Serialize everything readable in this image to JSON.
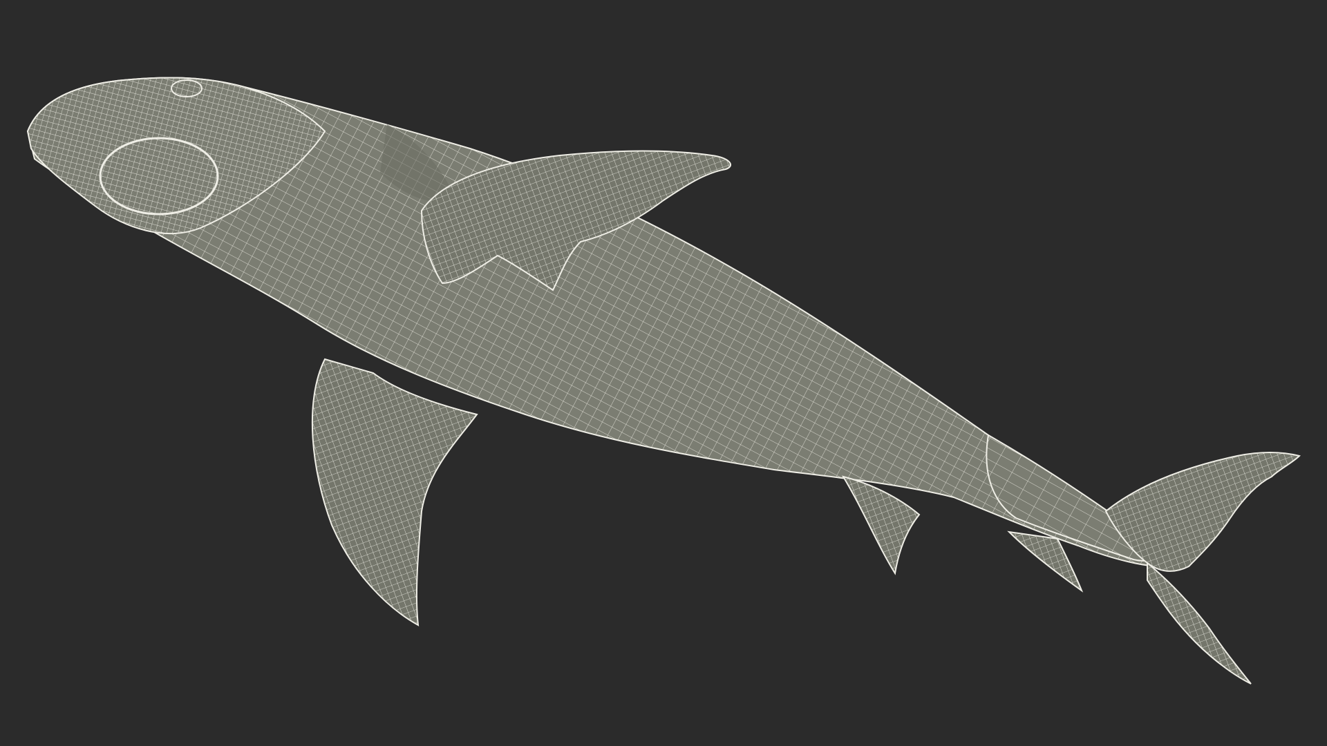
{
  "scene": {
    "subject": "shark-wireframe",
    "colors": {
      "background": "#2b2b2b",
      "surface": "#7b7d72",
      "surface_shadow": "#6c6e64",
      "wire": "#f1f0e8",
      "outline": "#efeee6"
    }
  }
}
